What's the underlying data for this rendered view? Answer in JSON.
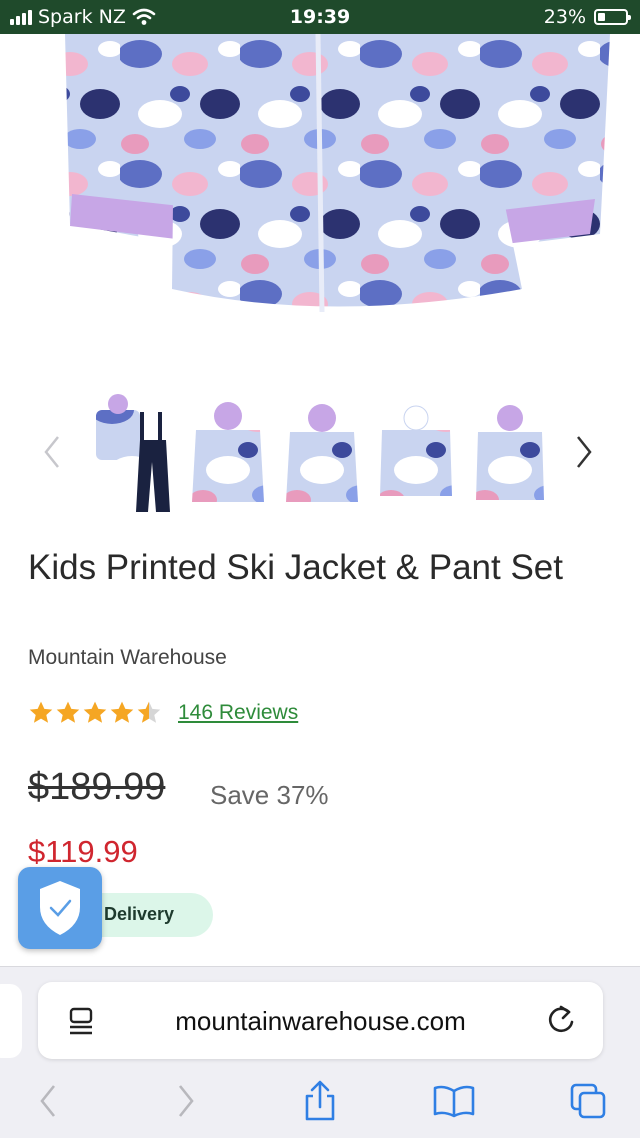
{
  "status_bar": {
    "carrier": "Spark NZ",
    "time": "19:39",
    "battery": "23%"
  },
  "product": {
    "title": "Kids Printed Ski Jacket & Pant Set",
    "brand": "Mountain Warehouse",
    "rating": 4.5,
    "rating_max": 5,
    "reviews_label": "146 Reviews",
    "old_price": "$189.99",
    "save_label": "Save 37%",
    "price": "$119.99",
    "delivery_label": "Delivery",
    "thumbnail_count": 6
  },
  "browser": {
    "url": "mountainwarehouse.com"
  },
  "colors": {
    "status_bg": "#1f4a2b",
    "price_red": "#d0262f",
    "review_green": "#2e8b3a",
    "star_gold": "#f5a623",
    "ios_blue": "#2f7fe4"
  }
}
